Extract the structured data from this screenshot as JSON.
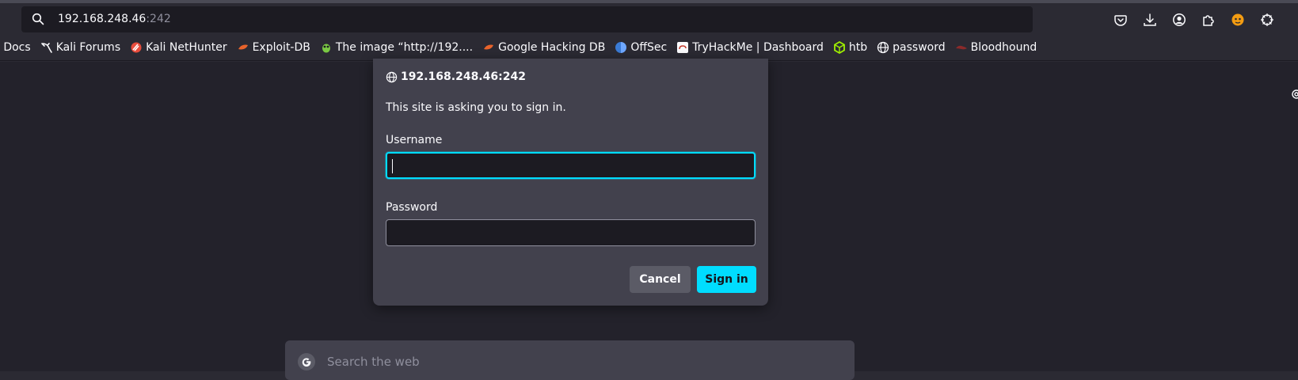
{
  "browser": {
    "url_host": "192.168.248.46",
    "url_port": ":242",
    "toolbar_icons": [
      "pocket-icon",
      "download-icon",
      "account-icon",
      "extensions-icon",
      "fox-extension-icon",
      "addon-icon"
    ]
  },
  "bookmarks": [
    {
      "label": "i Docs",
      "icon": "kali-docs-icon"
    },
    {
      "label": "Kali Forums",
      "icon": "kali-dragon-icon"
    },
    {
      "label": "Kali NetHunter",
      "icon": "nethunter-icon"
    },
    {
      "label": "Exploit-DB",
      "icon": "exploitdb-icon"
    },
    {
      "label": "The image “http://192....",
      "icon": "image-bug-icon"
    },
    {
      "label": "Google Hacking DB",
      "icon": "ghdb-icon"
    },
    {
      "label": "OffSec",
      "icon": "offsec-icon"
    },
    {
      "label": "TryHackMe | Dashboard",
      "icon": "tryhackme-icon"
    },
    {
      "label": "htb",
      "icon": "htb-cube-icon"
    },
    {
      "label": "password",
      "icon": "globe-icon"
    },
    {
      "label": "Bloodhound",
      "icon": "bloodhound-icon"
    }
  ],
  "dialog": {
    "origin": "192.168.248.46:242",
    "message": "This site is asking you to sign in.",
    "username_label": "Username",
    "username_value": "",
    "password_label": "Password",
    "password_value": "",
    "cancel_label": "Cancel",
    "signin_label": "Sign in"
  },
  "newtab": {
    "search_placeholder": "Search the web"
  },
  "colors": {
    "accent": "#00ddff",
    "background": "#2b2a33",
    "dialog": "#42414d"
  }
}
